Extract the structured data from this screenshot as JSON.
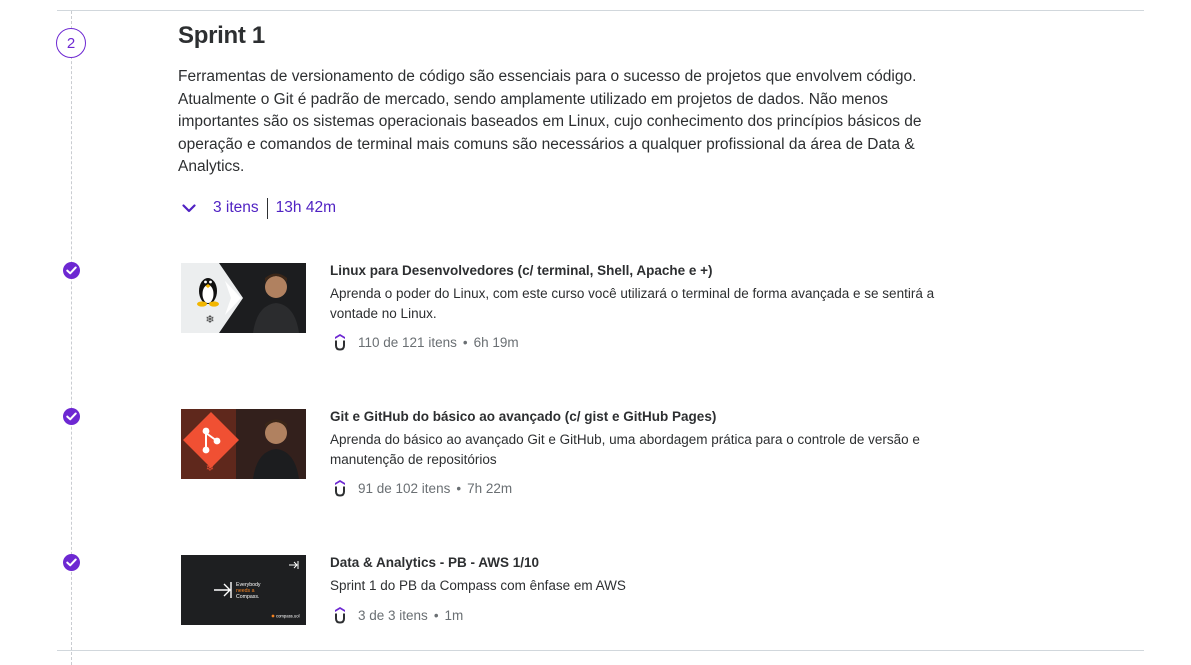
{
  "section": {
    "step_number": "2",
    "title": "Sprint 1",
    "description": "Ferramentas de versionamento de código são essenciais para o sucesso de projetos que envolvem código. Atualmente o Git é padrão de mercado, sendo amplamente utilizado em projetos de dados. Não menos importantes são os sistemas operacionais baseados em Linux, cujo conhecimento dos princípios básicos de operação e comandos de terminal mais comuns são necessários a qualquer profissional da área de Data & Analytics.",
    "items_count": "3 itens",
    "duration": "13h 42m",
    "expand_icon": "chevron-down-icon"
  },
  "courses": [
    {
      "title": "Linux para Desenvolvedores (c/ terminal, Shell, Apache e +)",
      "description": "Aprenda o poder do Linux, com este curso você utilizará o terminal de forma avançada e se sentirá a vontade no Linux.",
      "progress": "110 de 121 itens",
      "duration": "6h 19m",
      "completed": true
    },
    {
      "title": "Git e GitHub do básico ao avançado (c/ gist e GitHub Pages)",
      "description": "Aprenda do básico ao avançado Git e GitHub, uma abordagem prática para o controle de versão e manutenção de repositórios",
      "progress": "91 de 102 itens",
      "duration": "7h 22m",
      "completed": true
    },
    {
      "title": "Data & Analytics - PB - AWS 1/10",
      "description": "Sprint 1 do PB da Compass com ênfase em AWS",
      "progress": "3 de 3 itens",
      "duration": "1m",
      "completed": true,
      "thumbnail_text": "Everybody needs a Compass.",
      "thumbnail_brand": "compass.uol"
    }
  ],
  "stat_separator": "•",
  "colors": {
    "accent": "#6d28d2",
    "link": "#5022c3",
    "text": "#2d2f31",
    "muted": "#6a6f73",
    "divider": "#d1d7dc"
  },
  "icons": {
    "check": "check-circle-icon",
    "course_badge": "udemy-logo-icon"
  }
}
